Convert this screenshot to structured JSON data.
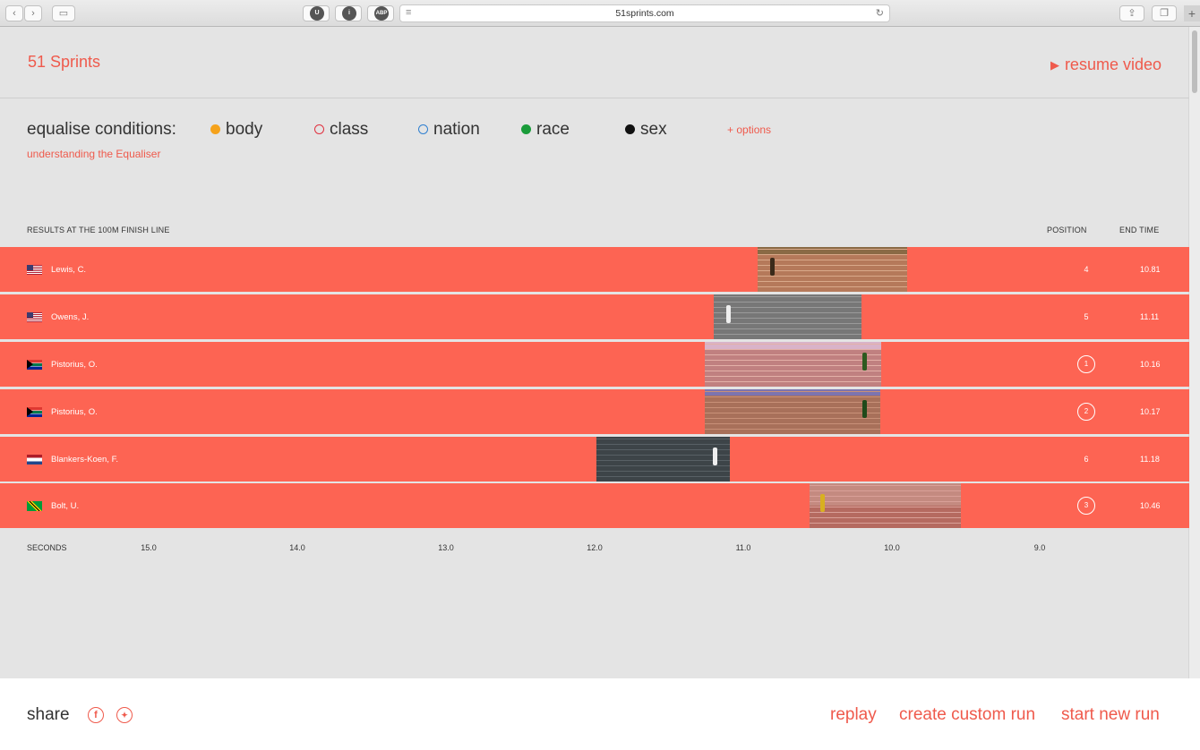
{
  "browser": {
    "url": "51sprints.com",
    "ext_labels": [
      "U",
      "i",
      "ABP"
    ]
  },
  "header": {
    "logo": "51 Sprints",
    "resume": "resume video"
  },
  "equaliser": {
    "label": "equalise conditions:",
    "conditions": [
      {
        "label": "body",
        "color": "#f5a21b",
        "filled": true
      },
      {
        "label": "class",
        "color": "#e0313f",
        "filled": false
      },
      {
        "label": "nation",
        "color": "#2f7fd0",
        "filled": false
      },
      {
        "label": "race",
        "color": "#1a9c3a",
        "filled": true
      },
      {
        "label": "sex",
        "color": "#111111",
        "filled": true
      }
    ],
    "options": "+ options",
    "understanding": "understanding the Equaliser"
  },
  "results": {
    "heading": "RESULTS AT THE 100M FINISH LINE",
    "position_header": "POSITION",
    "end_time_header": "END TIME",
    "rows": [
      {
        "name": "Lewis, C.",
        "flag": "usa",
        "position": "4",
        "medal": false,
        "end_time": "10.81"
      },
      {
        "name": "Owens, J.",
        "flag": "usa",
        "position": "5",
        "medal": false,
        "end_time": "11.11"
      },
      {
        "name": "Pistorius, O.",
        "flag": "rsa",
        "position": "1",
        "medal": true,
        "end_time": "10.16"
      },
      {
        "name": "Pistorius, O.",
        "flag": "rsa",
        "position": "2",
        "medal": true,
        "end_time": "10.17"
      },
      {
        "name": "Blankers-Koen, F.",
        "flag": "ned",
        "position": "6",
        "medal": false,
        "end_time": "11.18"
      },
      {
        "name": "Bolt, U.",
        "flag": "jam",
        "position": "3",
        "medal": true,
        "end_time": "10.46"
      }
    ],
    "axis_label": "SECONDS",
    "ticks": [
      "15.0",
      "14.0",
      "13.0",
      "12.0",
      "11.0",
      "10.0",
      "9.0"
    ]
  },
  "footer": {
    "share": "share",
    "replay": "replay",
    "create": "create custom run",
    "start": "start new run"
  },
  "colors": {
    "accent": "#ef5a4c",
    "row": "#fd6453"
  }
}
